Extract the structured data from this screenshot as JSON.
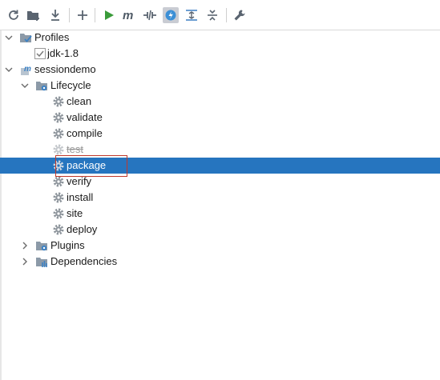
{
  "toolbar": {
    "icons": [
      "refresh-icon",
      "add-maven-project-icon",
      "download-icon",
      "add-icon",
      "run-icon",
      "maven-goal-icon",
      "toggle-offline-icon",
      "skip-tests-icon",
      "show-dependencies-icon",
      "collapse-all-icon",
      "settings-wrench-icon"
    ],
    "active": "skip-tests-icon"
  },
  "tree": {
    "profiles": {
      "label": "Profiles",
      "items": [
        {
          "label": "jdk-1.8",
          "checked": true
        }
      ]
    },
    "project": {
      "label": "sessiondemo",
      "lifecycle": {
        "label": "Lifecycle",
        "goals": [
          {
            "label": "clean"
          },
          {
            "label": "validate"
          },
          {
            "label": "compile"
          },
          {
            "label": "test",
            "skipped": true
          },
          {
            "label": "package",
            "selected": true
          },
          {
            "label": "verify"
          },
          {
            "label": "install"
          },
          {
            "label": "site"
          },
          {
            "label": "deploy"
          }
        ]
      },
      "plugins": {
        "label": "Plugins"
      },
      "dependencies": {
        "label": "Dependencies"
      }
    }
  },
  "colors": {
    "selection": "#2675bf",
    "highlight": "#c0392b",
    "run": "#3a9b3a"
  }
}
